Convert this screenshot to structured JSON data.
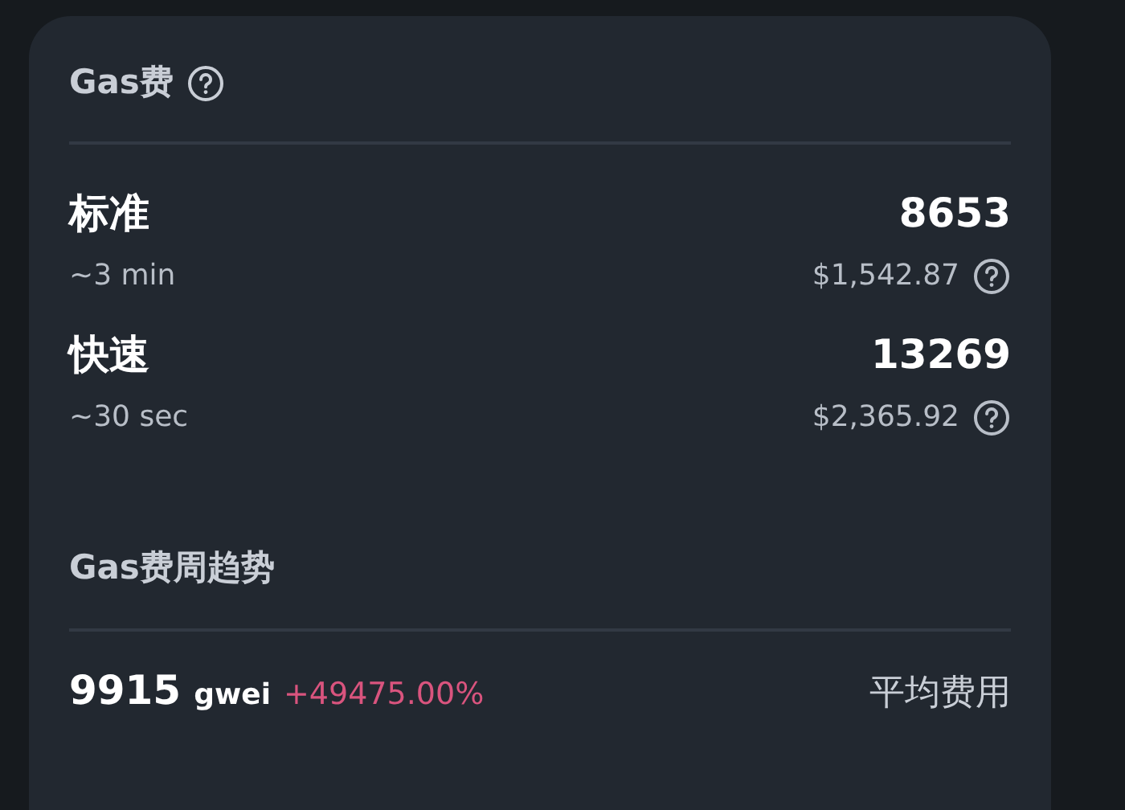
{
  "gas_fee": {
    "title": "Gas费",
    "options": [
      {
        "name": "标准",
        "time": "~3 min",
        "gwei": "8653",
        "usd": "$1,542.87"
      },
      {
        "name": "快速",
        "time": "~30 sec",
        "gwei": "13269",
        "usd": "$2,365.92"
      }
    ]
  },
  "weekly_trend": {
    "title": "Gas费周趋势",
    "value": "9915",
    "unit": "gwei",
    "change": "+49475.00%",
    "label": "平均费用"
  }
}
